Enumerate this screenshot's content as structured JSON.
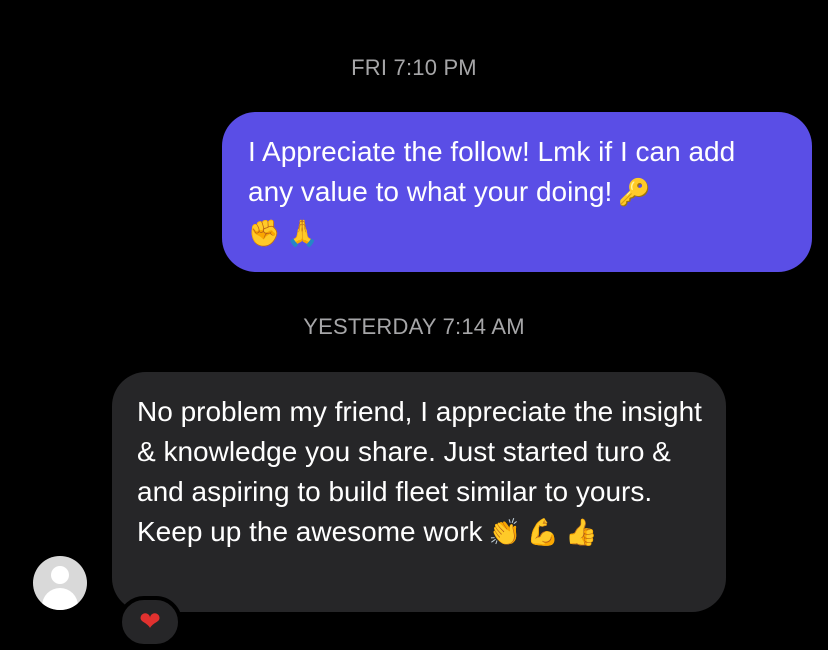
{
  "thread": {
    "timestamp_1": "FRI 7:10 PM",
    "timestamp_2": "YESTERDAY 7:14 AM"
  },
  "messages": [
    {
      "direction": "outgoing",
      "text": "I Appreciate the follow! Lmk if I can add any value to what your doing!",
      "emojis_inline": [
        "🔑"
      ],
      "emojis_line": [
        "✊",
        "🙏"
      ],
      "bubble_color": "#5a4ee6"
    },
    {
      "direction": "incoming",
      "text": "No problem my friend, I appreciate the insight & knowledge you share. Just started turo & and aspiring to build fleet similar to yours. Keep up the awesome work",
      "emojis_inline": [
        "👏",
        "💪",
        "👍"
      ],
      "bubble_color": "#262628",
      "reaction": "❤",
      "reaction_color": "#e0312f"
    }
  ],
  "avatar": {
    "icon": "default-user-avatar",
    "background": "#d9d9d9"
  }
}
